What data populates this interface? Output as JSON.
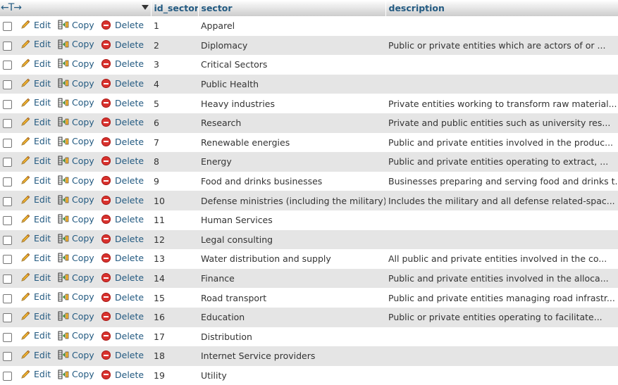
{
  "header": {
    "nav_arrows": "←T→",
    "columns": [
      "id_sector",
      "sector",
      "description"
    ]
  },
  "actions": {
    "edit": "Edit",
    "copy": "Copy",
    "delete": "Delete"
  },
  "rows": [
    {
      "id": "1",
      "sector": "Apparel",
      "description": ""
    },
    {
      "id": "2",
      "sector": "Diplomacy",
      "description": "Public or private entities which are actors of or ..."
    },
    {
      "id": "3",
      "sector": "Critical Sectors",
      "description": ""
    },
    {
      "id": "4",
      "sector": "Public Health",
      "description": ""
    },
    {
      "id": "5",
      "sector": "Heavy industries",
      "description": "Private entities working to transform raw material..."
    },
    {
      "id": "6",
      "sector": "Research",
      "description": "Private and public entities such as university res..."
    },
    {
      "id": "7",
      "sector": "Renewable energies",
      "description": "Public and private entities involved in the produc..."
    },
    {
      "id": "8",
      "sector": "Energy",
      "description": "Public and private entities operating to extract, ..."
    },
    {
      "id": "9",
      "sector": "Food and drinks businesses",
      "description": "Businesses preparing and serving food and drinks t..."
    },
    {
      "id": "10",
      "sector": "Defense ministries (including the military)",
      "description": "Includes the military and all defense related-spac..."
    },
    {
      "id": "11",
      "sector": "Human Services",
      "description": ""
    },
    {
      "id": "12",
      "sector": "Legal consulting",
      "description": ""
    },
    {
      "id": "13",
      "sector": "Water distribution and supply",
      "description": "All public and private entities involved in the co..."
    },
    {
      "id": "14",
      "sector": "Finance",
      "description": "Public and private entities involved in the alloca..."
    },
    {
      "id": "15",
      "sector": "Road transport",
      "description": "Public and private entities managing road infrastr..."
    },
    {
      "id": "16",
      "sector": "Education",
      "description": "Public or private entities operating to facilitate..."
    },
    {
      "id": "17",
      "sector": "Distribution",
      "description": ""
    },
    {
      "id": "18",
      "sector": "Internet Service providers",
      "description": ""
    },
    {
      "id": "19",
      "sector": "Utility",
      "description": ""
    }
  ]
}
